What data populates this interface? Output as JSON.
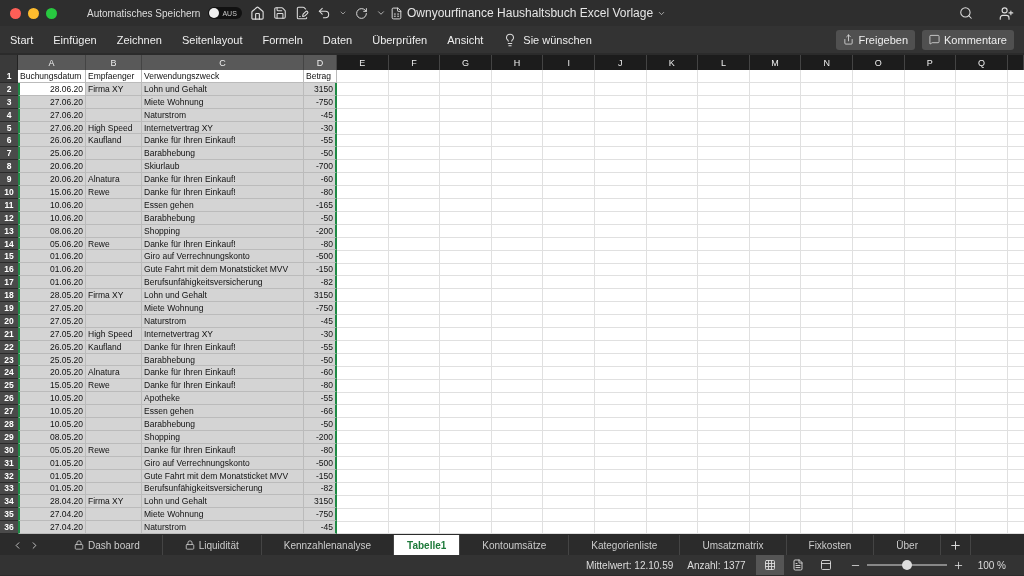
{
  "titlebar": {
    "autosave_label": "Automatisches Speichern",
    "autosave": {
      "on": false,
      "label": "AUS"
    },
    "title": "Ownyourfinance Haushaltsbuch Excel Vorlage"
  },
  "ribbon": {
    "tabs": [
      "Start",
      "Einfügen",
      "Zeichnen",
      "Seitenlayout",
      "Formeln",
      "Daten",
      "Überprüfen",
      "Ansicht"
    ],
    "tell_me": "Sie wünschen",
    "share": "Freigeben",
    "comments": "Kommentare"
  },
  "sheet": {
    "columns": [
      {
        "label": "A",
        "selected": true
      },
      {
        "label": "B",
        "selected": true
      },
      {
        "label": "C",
        "selected": true
      },
      {
        "label": "D",
        "selected": true
      },
      {
        "label": "E",
        "selected": false
      },
      {
        "label": "F",
        "selected": false
      },
      {
        "label": "G",
        "selected": false
      },
      {
        "label": "H",
        "selected": false
      },
      {
        "label": "I",
        "selected": false
      },
      {
        "label": "J",
        "selected": false
      },
      {
        "label": "K",
        "selected": false
      },
      {
        "label": "L",
        "selected": false
      },
      {
        "label": "M",
        "selected": false
      },
      {
        "label": "N",
        "selected": false
      },
      {
        "label": "O",
        "selected": false
      },
      {
        "label": "P",
        "selected": false
      },
      {
        "label": "Q",
        "selected": false
      }
    ],
    "rows": [
      {
        "n": "1",
        "kind": "header",
        "date": "Buchungsdatum",
        "payee": "Empfaenger",
        "purpose": "Verwendungszweck",
        "amount": "Betrag",
        "selected": false,
        "active": false
      },
      {
        "n": "2",
        "date": "28.06.20",
        "payee": "Firma XY",
        "purpose": "Lohn und Gehalt",
        "amount": "3150",
        "selected": true,
        "active": true
      },
      {
        "n": "3",
        "date": "27.06.20",
        "purpose": "Miete Wohnung",
        "amount": "-750",
        "selected": true,
        "active": false
      },
      {
        "n": "4",
        "date": "27.06.20",
        "purpose": "Naturstrom",
        "amount": "-45",
        "selected": true,
        "active": false
      },
      {
        "n": "5",
        "date": "27.06.20",
        "payee": "High Speed",
        "purpose": "Internetvertrag XY",
        "amount": "-30",
        "selected": true,
        "active": false
      },
      {
        "n": "6",
        "date": "26.06.20",
        "payee": "Kaufland",
        "purpose": "Danke für Ihren Einkauf!",
        "amount": "-55",
        "selected": true,
        "active": false
      },
      {
        "n": "7",
        "date": "25.06.20",
        "purpose": "Barabhebung",
        "amount": "-50",
        "selected": true,
        "active": false
      },
      {
        "n": "8",
        "date": "20.06.20",
        "purpose": "Skiurlaub",
        "amount": "-700",
        "selected": true,
        "active": false
      },
      {
        "n": "9",
        "date": "20.06.20",
        "payee": "Alnatura",
        "purpose": "Danke für Ihren Einkauf!",
        "amount": "-60",
        "selected": true,
        "active": false
      },
      {
        "n": "10",
        "date": "15.06.20",
        "payee": "Rewe",
        "purpose": "Danke für Ihren Einkauf!",
        "amount": "-80",
        "selected": true,
        "active": false
      },
      {
        "n": "11",
        "date": "10.06.20",
        "purpose": "Essen gehen",
        "amount": "-165",
        "selected": true,
        "active": false
      },
      {
        "n": "12",
        "date": "10.06.20",
        "purpose": "Barabhebung",
        "amount": "-50",
        "selected": true,
        "active": false
      },
      {
        "n": "13",
        "date": "08.06.20",
        "purpose": "Shopping",
        "amount": "-200",
        "selected": true,
        "active": false
      },
      {
        "n": "14",
        "date": "05.06.20",
        "payee": "Rewe",
        "purpose": "Danke für Ihren Einkauf!",
        "amount": "-80",
        "selected": true,
        "active": false
      },
      {
        "n": "15",
        "date": "01.06.20",
        "purpose": "Giro auf Verrechnungskonto",
        "amount": "-500",
        "selected": true,
        "active": false
      },
      {
        "n": "16",
        "date": "01.06.20",
        "purpose": "Gute Fahrt mit dem Monatsticket MVV",
        "amount": "-150",
        "selected": true,
        "active": false
      },
      {
        "n": "17",
        "date": "01.06.20",
        "purpose": "Berufsunfähigkeitsversicherung",
        "amount": "-82",
        "selected": true,
        "active": false
      },
      {
        "n": "18",
        "date": "28.05.20",
        "payee": "Firma XY",
        "purpose": "Lohn und Gehalt",
        "amount": "3150",
        "selected": true,
        "active": false
      },
      {
        "n": "19",
        "date": "27.05.20",
        "purpose": "Miete Wohnung",
        "amount": "-750",
        "selected": true,
        "active": false
      },
      {
        "n": "20",
        "date": "27.05.20",
        "purpose": "Naturstrom",
        "amount": "-45",
        "selected": true,
        "active": false
      },
      {
        "n": "21",
        "date": "27.05.20",
        "payee": "High Speed",
        "purpose": "Internetvertrag XY",
        "amount": "-30",
        "selected": true,
        "active": false
      },
      {
        "n": "22",
        "date": "26.05.20",
        "payee": "Kaufland",
        "purpose": "Danke für Ihren Einkauf!",
        "amount": "-55",
        "selected": true,
        "active": false
      },
      {
        "n": "23",
        "date": "25.05.20",
        "purpose": "Barabhebung",
        "amount": "-50",
        "selected": true,
        "active": false
      },
      {
        "n": "24",
        "date": "20.05.20",
        "payee": "Alnatura",
        "purpose": "Danke für Ihren Einkauf!",
        "amount": "-60",
        "selected": true,
        "active": false
      },
      {
        "n": "25",
        "date": "15.05.20",
        "payee": "Rewe",
        "purpose": "Danke für Ihren Einkauf!",
        "amount": "-80",
        "selected": true,
        "active": false
      },
      {
        "n": "26",
        "date": "10.05.20",
        "purpose": "Apotheke",
        "amount": "-55",
        "selected": true,
        "active": false
      },
      {
        "n": "27",
        "date": "10.05.20",
        "purpose": "Essen gehen",
        "amount": "-66",
        "selected": true,
        "active": false
      },
      {
        "n": "28",
        "date": "10.05.20",
        "purpose": "Barabhebung",
        "amount": "-50",
        "selected": true,
        "active": false
      },
      {
        "n": "29",
        "date": "08.05.20",
        "purpose": "Shopping",
        "amount": "-200",
        "selected": true,
        "active": false
      },
      {
        "n": "30",
        "date": "05.05.20",
        "payee": "Rewe",
        "purpose": "Danke für Ihren Einkauf!",
        "amount": "-80",
        "selected": true,
        "active": false
      },
      {
        "n": "31",
        "date": "01.05.20",
        "purpose": "Giro auf Verrechnungskonto",
        "amount": "-500",
        "selected": true,
        "active": false
      },
      {
        "n": "32",
        "date": "01.05.20",
        "purpose": "Gute Fahrt mit dem Monatsticket MVV",
        "amount": "-150",
        "selected": true,
        "active": false
      },
      {
        "n": "33",
        "date": "01.05.20",
        "purpose": "Berufsunfähigkeitsversicherung",
        "amount": "-82",
        "selected": true,
        "active": false
      },
      {
        "n": "34",
        "date": "28.04.20",
        "payee": "Firma XY",
        "purpose": "Lohn und Gehalt",
        "amount": "3150",
        "selected": true,
        "active": false
      },
      {
        "n": "35",
        "date": "27.04.20",
        "purpose": "Miete Wohnung",
        "amount": "-750",
        "selected": true,
        "active": false
      },
      {
        "n": "36",
        "date": "27.04.20",
        "purpose": "Naturstrom",
        "amount": "-45",
        "selected": true,
        "active": false
      }
    ]
  },
  "sheet_tabs": [
    {
      "label": "Dash board",
      "locked": true,
      "selected": false
    },
    {
      "label": "Liquidität",
      "locked": true,
      "selected": false
    },
    {
      "label": "Kennzahlenanalyse",
      "locked": false,
      "selected": false
    },
    {
      "label": "Tabelle1",
      "locked": false,
      "selected": true
    },
    {
      "label": "Kontoumsätze",
      "locked": false,
      "selected": false
    },
    {
      "label": "Kategorienliste",
      "locked": false,
      "selected": false
    },
    {
      "label": "Umsatzmatrix",
      "locked": false,
      "selected": false
    },
    {
      "label": "Fixkosten",
      "locked": false,
      "selected": false
    },
    {
      "label": "Über",
      "locked": false,
      "selected": false
    }
  ],
  "status_bar": {
    "average": "Mittelwert: 12.10.59",
    "count": "Anzahl: 1377",
    "views": [
      {
        "kind": "normal",
        "selected": true
      },
      {
        "kind": "layout",
        "selected": false
      },
      {
        "kind": "pagebreak",
        "selected": false
      }
    ],
    "zoom": {
      "level": 0.5,
      "reading": "100 %"
    }
  }
}
